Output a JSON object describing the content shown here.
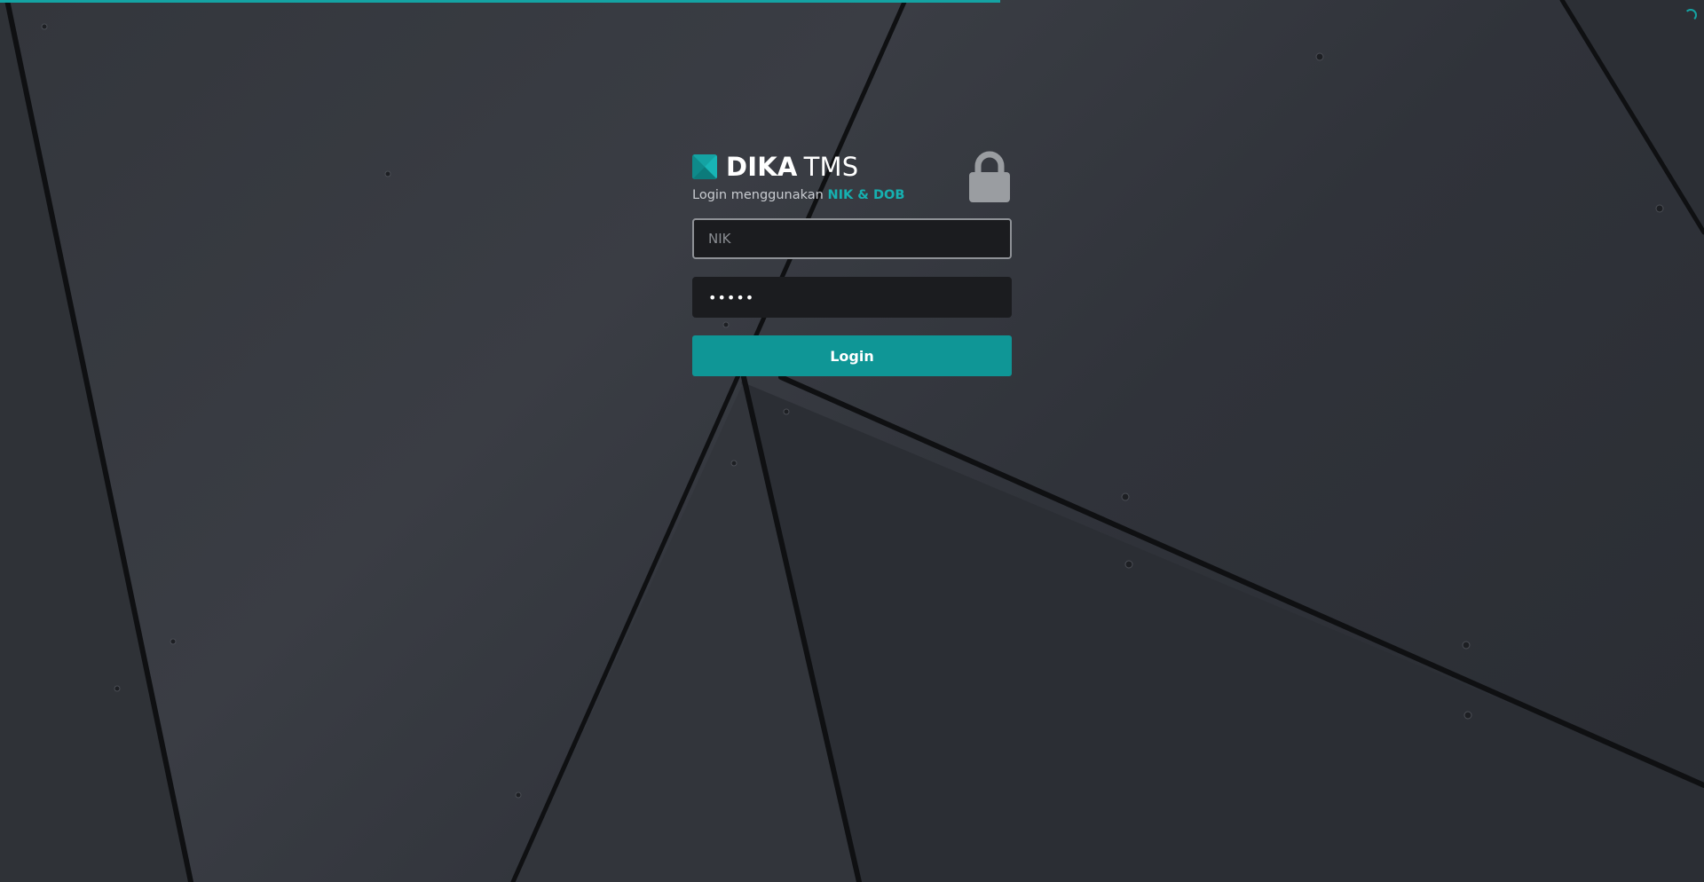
{
  "brand": {
    "name_bold": "DIKA",
    "name_light": "TMS",
    "accent_color": "#14a3a3"
  },
  "subtitle": {
    "prefix": "Login menggunakan",
    "highlight": "NIK & DOB"
  },
  "form": {
    "nik_placeholder": "NIK",
    "nik_value": "",
    "password_value": "12345",
    "login_label": "Login"
  },
  "icons": {
    "logo": "logo-mark-icon",
    "lock": "lock-icon",
    "spinner": "loading-spinner-icon"
  },
  "page_load_progress": 0.587
}
